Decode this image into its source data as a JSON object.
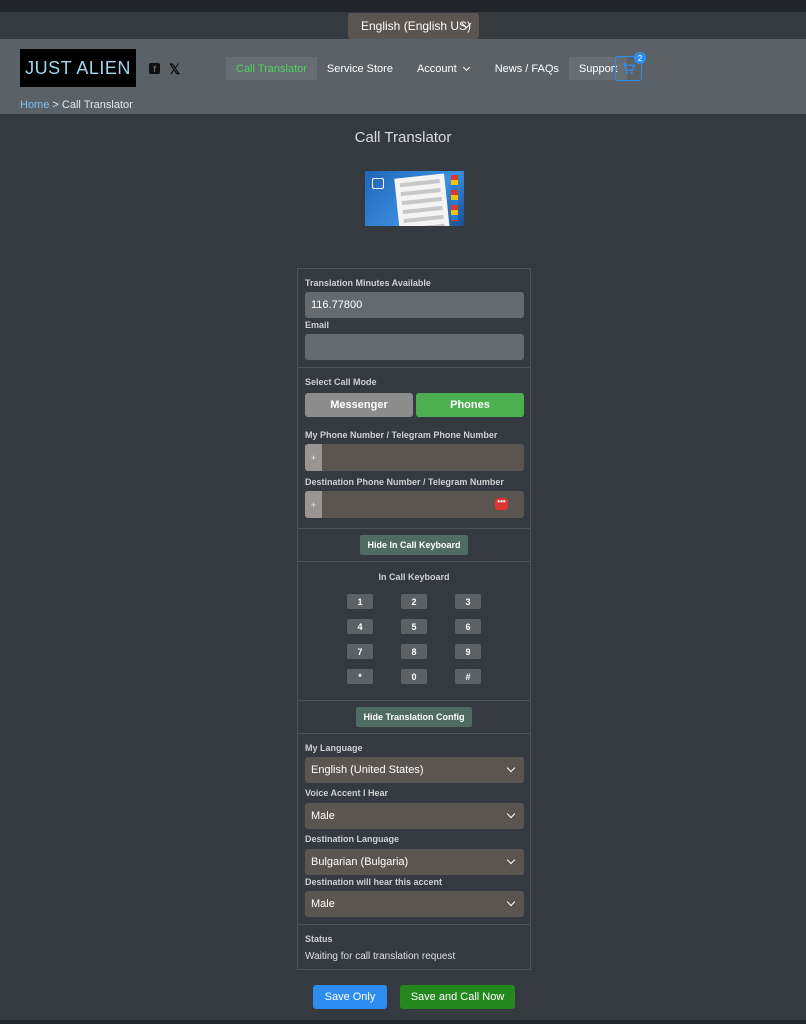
{
  "language_selector": {
    "value": "English (English US)"
  },
  "header": {
    "logo": "JUST ALIEN",
    "nav": [
      {
        "label": "Call Translator"
      },
      {
        "label": "Service Store"
      },
      {
        "label": "Account"
      },
      {
        "label": "News / FAQs"
      },
      {
        "label": "Support"
      }
    ],
    "cart_count": "2"
  },
  "breadcrumb": {
    "home": "Home",
    "separator": ">",
    "current": "Call Translator"
  },
  "page_title": "Call Translator",
  "form": {
    "minutes_label": "Translation Minutes Available",
    "minutes_value": "116.77800",
    "email_label": "Email",
    "email_value": "",
    "call_mode_label": "Select Call Mode",
    "mode_messenger": "Messenger",
    "mode_phones": "Phones",
    "my_phone_label": "My Phone Number / Telegram Phone Number",
    "dest_phone_label": "Destination Phone Number / Telegram Number",
    "phone_prefix": "+",
    "hide_keyboard_button": "Hide In Call Keyboard",
    "keyboard_title": "In Call Keyboard",
    "keys": [
      "1",
      "2",
      "3",
      "4",
      "5",
      "6",
      "7",
      "8",
      "9",
      "*",
      "0",
      "#"
    ],
    "hide_config_button": "Hide Translation Config",
    "my_language_label": "My Language",
    "my_language_value": "English (United States)",
    "voice_accent_label": "Voice Accent I Hear",
    "voice_accent_value": "Male",
    "dest_language_label": "Destination Language",
    "dest_language_value": "Bulgarian (Bulgaria)",
    "dest_accent_label": "Destination will hear this accent",
    "dest_accent_value": "Male",
    "status_label": "Status",
    "status_value": "Waiting for call translation request"
  },
  "actions": {
    "save_only": "Save Only",
    "save_and_call": "Save and Call Now"
  },
  "colors": {
    "accent_green": "#53d05a",
    "phones_green": "#4caf50",
    "primary_blue": "#2d8cf0",
    "call_green": "#23881e"
  }
}
